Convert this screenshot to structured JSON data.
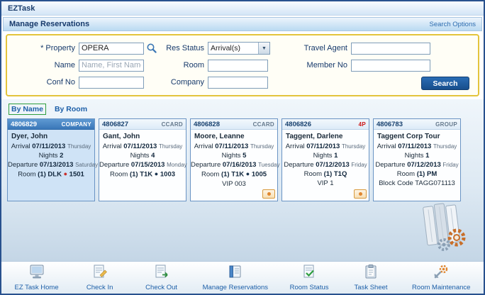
{
  "window": {
    "title": "EZTask"
  },
  "header": {
    "title": "Manage Reservations",
    "search_options_link": "Search Options"
  },
  "form": {
    "property_label": "* Property",
    "property_value": "OPERA",
    "res_status_label": "Res Status",
    "res_status_value": "Arrival(s)",
    "travel_agent_label": "Travel Agent",
    "travel_agent_value": "",
    "name_label": "Name",
    "name_placeholder": "Name, First Name",
    "room_label": "Room",
    "room_value": "",
    "member_no_label": "Member No",
    "member_no_value": "",
    "conf_no_label": "Conf No",
    "conf_no_value": "",
    "company_label": "Company",
    "company_value": "",
    "search_button_label": "Search"
  },
  "tabs": {
    "by_name": "By Name",
    "by_room": "By Room"
  },
  "card_labels": {
    "arrival": "Arrival",
    "nights": "Nights",
    "departure": "Departure",
    "room": "Room"
  },
  "cards": [
    {
      "conf": "4806829",
      "badge": "COMPANY",
      "badge_color": "#ffffff",
      "selected": true,
      "guest": "Dyer, John",
      "arrival_date": "07/11/2013",
      "arrival_day": "Thursday",
      "nights": "2",
      "departure_date": "07/13/2013",
      "departure_day": "Saturday",
      "room_type": "(1) DLK",
      "room_no": "1501",
      "room_status_color": "#c9302c",
      "extra": ""
    },
    {
      "conf": "4806827",
      "badge": "CCARD",
      "badge_color": "#64788c",
      "selected": false,
      "guest": "Gant, John",
      "arrival_date": "07/11/2013",
      "arrival_day": "Thursday",
      "nights": "4",
      "departure_date": "07/15/2013",
      "departure_day": "Monday",
      "room_type": "(1) T1K",
      "room_no": "1003",
      "room_status_color": "#1b3550",
      "extra": ""
    },
    {
      "conf": "4806828",
      "badge": "CCARD",
      "badge_color": "#64788c",
      "selected": false,
      "guest": "Moore, Leanne",
      "arrival_date": "07/11/2013",
      "arrival_day": "Thursday",
      "nights": "5",
      "departure_date": "07/16/2013",
      "departure_day": "Tuesday",
      "room_type": "(1) T1K",
      "room_no": "1005",
      "room_status_color": "#1b3550",
      "extra": "VIP 003"
    },
    {
      "conf": "4806826",
      "badge": "4P",
      "badge_color": "#cc1111",
      "selected": false,
      "guest": "Taggent, Darlene",
      "arrival_date": "07/11/2013",
      "arrival_day": "Thursday",
      "nights": "1",
      "departure_date": "07/12/2013",
      "departure_day": "Friday",
      "room_type": "(1) T1Q",
      "room_no": "",
      "extra": "VIP 1"
    },
    {
      "conf": "4806783",
      "badge": "GROUP",
      "badge_color": "#64788c",
      "selected": false,
      "guest": "Taggent Corp Tour",
      "arrival_date": "07/11/2013",
      "arrival_day": "Thursday",
      "nights": "1",
      "departure_date": "07/12/2013",
      "departure_day": "Friday",
      "room_type": "(1) PM",
      "room_no": "",
      "extra": "Block Code TAGG071113"
    }
  ],
  "toolbar": {
    "items": [
      {
        "label": "EZ Task Home"
      },
      {
        "label": "Check In"
      },
      {
        "label": "Check Out"
      },
      {
        "label": "Manage Reservations"
      },
      {
        "label": "Room Status"
      },
      {
        "label": "Task Sheet"
      },
      {
        "label": "Room Maintenance"
      }
    ]
  },
  "colors": {
    "accent_blue": "#1e5fa8",
    "selected_card_header": "#3a77b8",
    "selected_card_body": "#cfe3f6",
    "form_border_gold": "#e3c43c",
    "tab_selected_border": "#2f9e3f",
    "search_button": "#174e8c"
  }
}
